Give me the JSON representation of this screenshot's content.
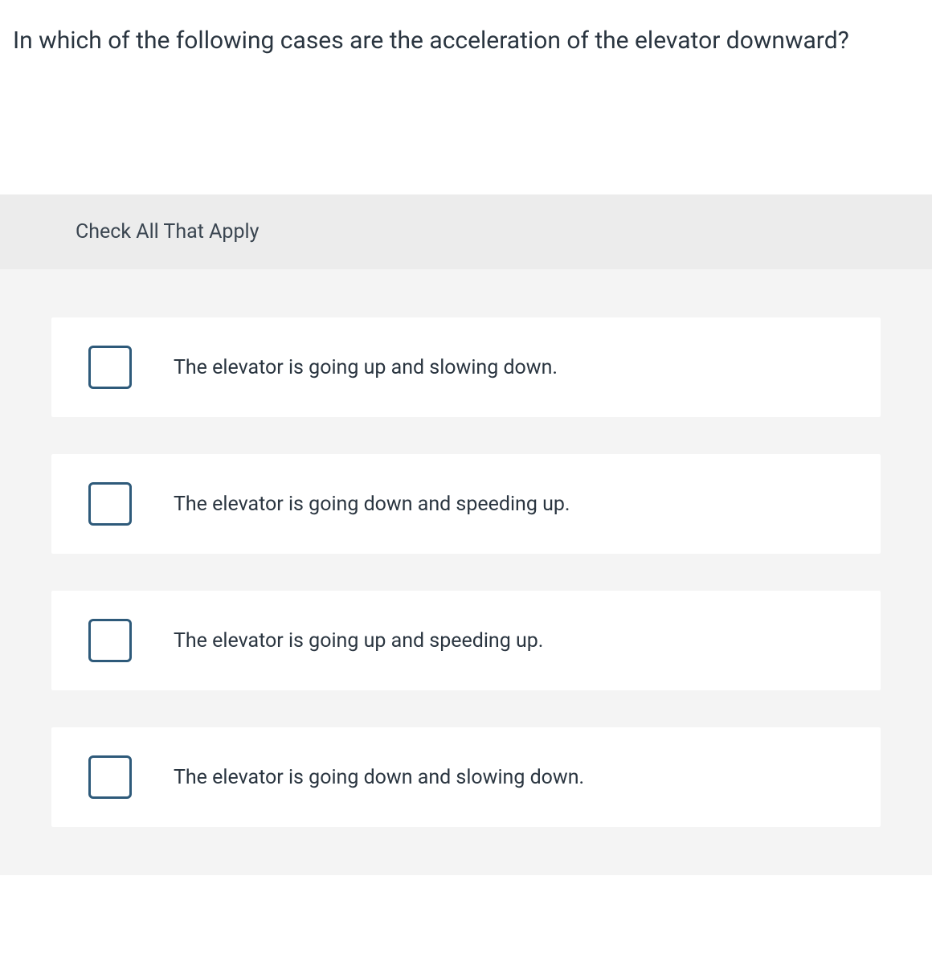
{
  "question": "In which of the following cases are the acceleration of the elevator downward?",
  "instruction": "Check All That Apply",
  "options": [
    {
      "label": "The elevator is going up and slowing down."
    },
    {
      "label": "The elevator is going down and speeding up."
    },
    {
      "label": "The elevator is going up and speeding up."
    },
    {
      "label": "The elevator is going down and slowing down."
    }
  ]
}
